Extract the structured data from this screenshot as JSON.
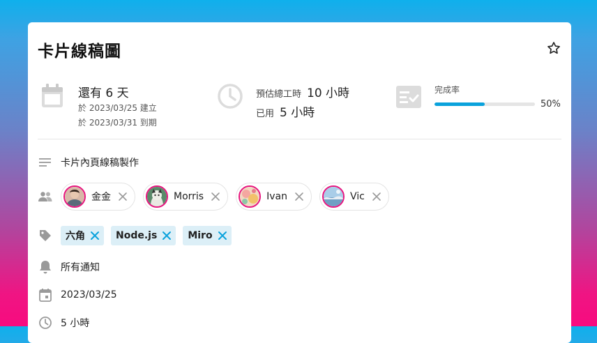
{
  "card": {
    "title": "卡片線稿圖",
    "star_icon": "star-outline-icon"
  },
  "stats": {
    "due": {
      "icon": "calendar-icon",
      "remaining": "還有 6 天",
      "created": "於 2023/03/25 建立",
      "due_date": "於 2023/03/31 到期"
    },
    "hours": {
      "icon": "clock-icon",
      "estimate_label": "預估總工時",
      "estimate_value": "10 小時",
      "used_label": "已用",
      "used_value": "5 小時"
    },
    "completion": {
      "icon": "checklist-icon",
      "label": "完成率",
      "percent_text": "50%",
      "fraction": 0.5,
      "color": "#0aa2dc"
    }
  },
  "description": {
    "icon": "lines-icon",
    "text": "卡片內頁線稿製作"
  },
  "members": {
    "icon": "people-icon",
    "items": [
      {
        "name": "金金",
        "avatar": "avatar-icon"
      },
      {
        "name": "Morris",
        "avatar": "avatar-icon"
      },
      {
        "name": "Ivan",
        "avatar": "avatar-icon"
      },
      {
        "name": "Vic",
        "avatar": "avatar-icon"
      }
    ]
  },
  "tags": {
    "icon": "tag-icon",
    "items": [
      "六角",
      "Node.js",
      "Miro"
    ],
    "color": "#dceff7",
    "remove_color": "#0aa2dc"
  },
  "notify": {
    "icon": "bell-icon",
    "text": "所有通知"
  },
  "date": {
    "icon": "calendar-icon",
    "text": "2023/03/25"
  },
  "time": {
    "icon": "clock-icon",
    "text": "5 小時"
  }
}
